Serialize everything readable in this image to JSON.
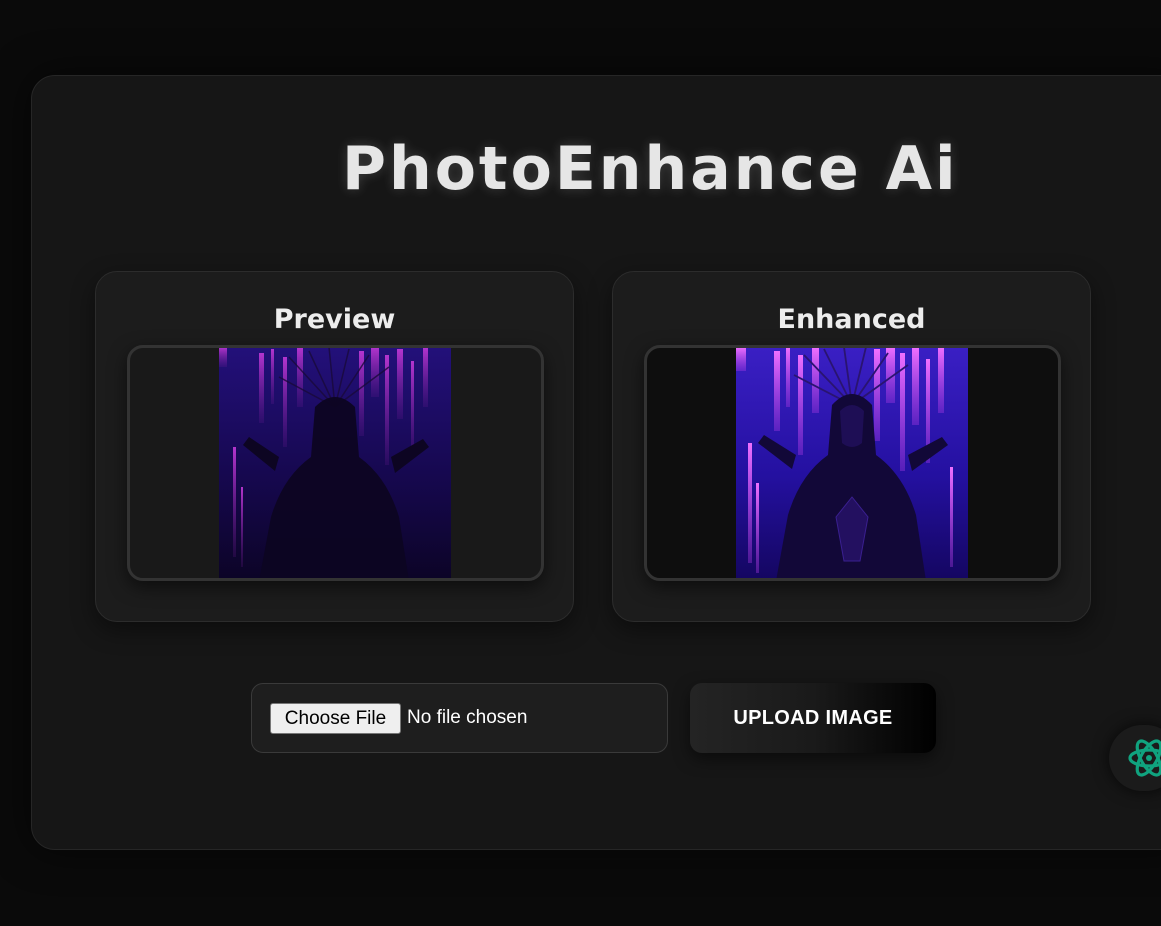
{
  "app": {
    "title": "PhotoEnhance Ai"
  },
  "panels": {
    "preview": {
      "label": "Preview",
      "image": "dark-purple-figure-image"
    },
    "enhanced": {
      "label": "Enhanced",
      "image": "enhanced-purple-figure-image"
    }
  },
  "upload": {
    "choose_label": "Choose File",
    "file_status": "No file chosen",
    "upload_label": "UPLOAD IMAGE"
  },
  "assistant": {
    "icon": "atom-assistant-icon"
  },
  "colors": {
    "background": "#0a0a0a",
    "card": "#161616",
    "panel": "#1c1c1c",
    "accent_magenta": "#e048ff",
    "accent_blue": "#2a17a0",
    "assistant_teal": "#10a37f"
  }
}
